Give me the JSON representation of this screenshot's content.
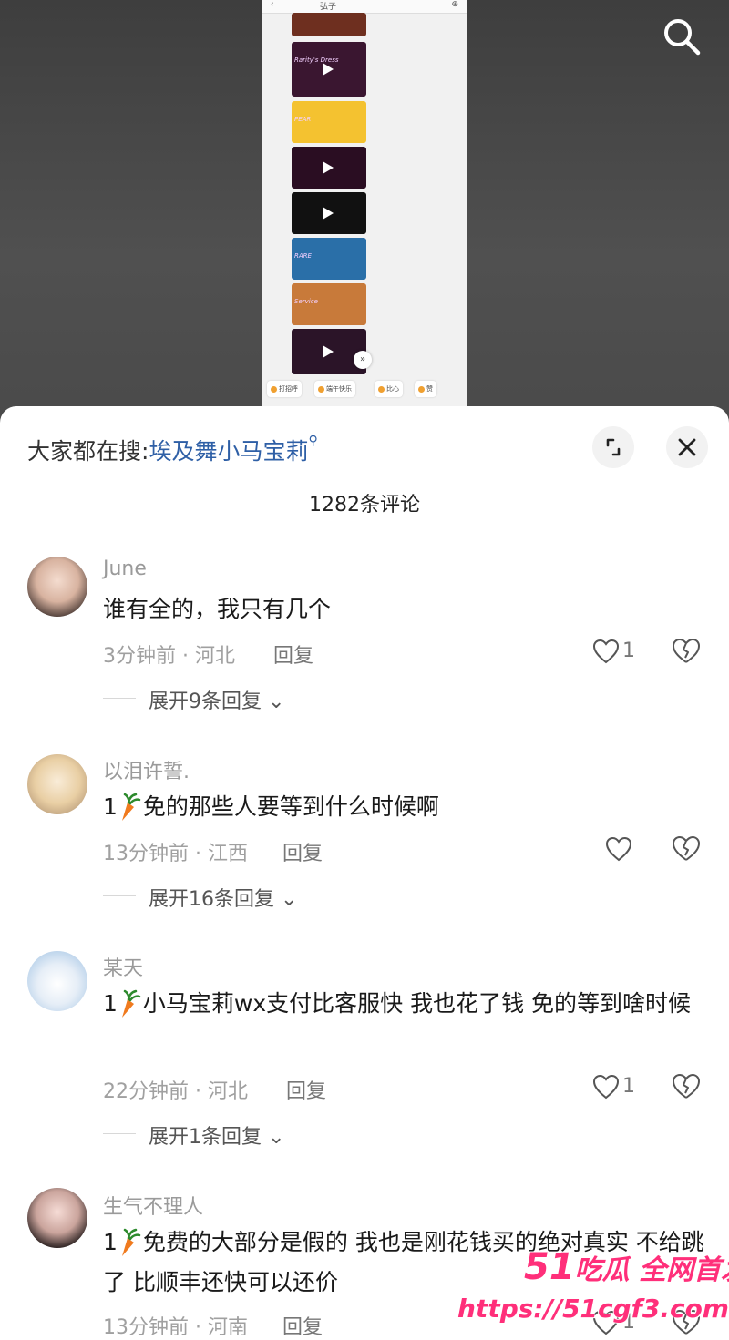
{
  "video": {
    "phone_title": "弘子",
    "phone_back": "‹",
    "phone_right": "⊕",
    "thumbnails": [
      {
        "color": "#6e2f1f",
        "caption": ""
      },
      {
        "color": "#3a1630",
        "caption": "Rarity's Dress"
      },
      {
        "color": "#f4c230",
        "caption": "PEAR"
      },
      {
        "color": "#2a0d22",
        "caption": ""
      },
      {
        "color": "#111111",
        "caption": ""
      },
      {
        "color": "#2a6fa8",
        "caption": "RARE"
      },
      {
        "color": "#c87a3a",
        "caption": "Service"
      },
      {
        "color": "#2b1428",
        "caption": ""
      }
    ],
    "chips": [
      "打招呼",
      "端午快乐",
      "比心",
      "赞"
    ],
    "icon": "search-icon"
  },
  "panel": {
    "hot_prefix": "大家都在搜:",
    "hot_keyword": "埃及舞小马宝莉",
    "count_text": "1282条评论",
    "expand_icon": "expand-icon",
    "close_icon": "close-icon"
  },
  "comments": [
    {
      "user": "June",
      "text": "谁有全的，我只有几个",
      "has_carrot": false,
      "time_loc": "3分钟前 · 河北",
      "reply": "回复",
      "likes": "1",
      "expand": "展开9条回复",
      "avatar_color": "#d9b7a8"
    },
    {
      "user": "以泪许誓.",
      "text_prefix": "1",
      "text": "免的那些人要等到什么时候啊",
      "has_carrot": true,
      "time_loc": "13分钟前 · 江西",
      "reply": "回复",
      "likes": "",
      "expand": "展开16条回复",
      "avatar_color": "#efd9b8"
    },
    {
      "user": "某天",
      "text_prefix": "1",
      "text": "小马宝莉wx支付比客服快 我也花了钱 免的等到啥时候",
      "has_carrot": true,
      "time_loc": "22分钟前 · 河北",
      "reply": "回复",
      "likes": "1",
      "expand": "展开1条回复",
      "avatar_color": "#c9dff0"
    },
    {
      "user": "生气不理人",
      "text_prefix": "1",
      "text": "免费的大部分是假的 我也是刚花钱买的绝对真实 不给跳了 比顺丰还快可以还价",
      "has_carrot": true,
      "time_loc": "13分钟前 · 河南",
      "reply": "回复",
      "likes": "1",
      "expand": "",
      "avatar_color": "#3a2a2a"
    }
  ],
  "watermark": {
    "line1_big": "51",
    "line1": "吃瓜 全网首发",
    "line2": "https://51cgf3.com"
  }
}
